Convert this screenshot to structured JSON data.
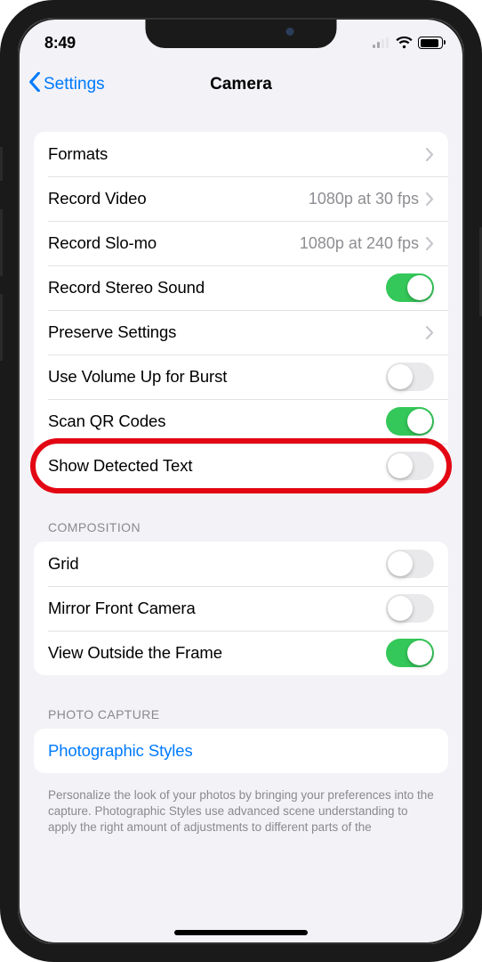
{
  "status": {
    "time": "8:49"
  },
  "nav": {
    "back_label": "Settings",
    "title": "Camera"
  },
  "sections": {
    "main": {
      "formats": {
        "label": "Formats"
      },
      "record_video": {
        "label": "Record Video",
        "detail": "1080p at 30 fps"
      },
      "record_slomo": {
        "label": "Record Slo-mo",
        "detail": "1080p at 240 fps"
      },
      "stereo_sound": {
        "label": "Record Stereo Sound",
        "on": true
      },
      "preserve": {
        "label": "Preserve Settings"
      },
      "volume_burst": {
        "label": "Use Volume Up for Burst",
        "on": false
      },
      "scan_qr": {
        "label": "Scan QR Codes",
        "on": true
      },
      "show_detected_text": {
        "label": "Show Detected Text",
        "on": false
      }
    },
    "composition": {
      "header": "COMPOSITION",
      "grid": {
        "label": "Grid",
        "on": false
      },
      "mirror_front": {
        "label": "Mirror Front Camera",
        "on": false
      },
      "view_outside": {
        "label": "View Outside the Frame",
        "on": true
      }
    },
    "photo_capture": {
      "header": "PHOTO CAPTURE",
      "styles": {
        "label": "Photographic Styles"
      },
      "footer": "Personalize the look of your photos by bringing your preferences into the capture. Photographic Styles use advanced scene understanding to apply the right amount of adjustments to different parts of the"
    }
  }
}
